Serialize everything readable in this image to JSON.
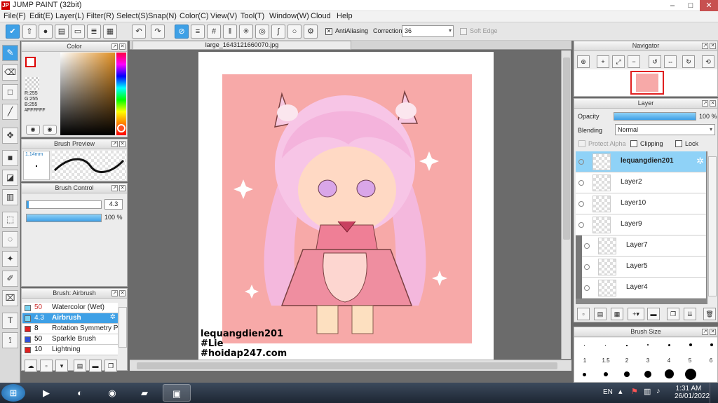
{
  "window": {
    "title": "JUMP PAINT (32bit)",
    "app_icon_text": "JP",
    "min": "–",
    "max": "□",
    "close": "✕"
  },
  "menu": [
    "File(F)",
    "Edit(E)",
    "Layer(L)",
    "Filter(R)",
    "Select(S)",
    "Snap(N)",
    "Color(C)",
    "View(V)",
    "Tool(T)",
    "Window(W)",
    "Cloud",
    "Help"
  ],
  "toolbar": {
    "antialiasing_label": "AntiAliasing",
    "correction_label": "Correction",
    "correction_value": "36",
    "soft_edge_label": "Soft Edge"
  },
  "document_tab": "large_1643121660070.jpg",
  "color_panel": {
    "title": "Color",
    "r": "R:255",
    "g": "G:255",
    "b": "B:255",
    "hex": "#FFFFFF"
  },
  "brush_preview": {
    "title": "Brush Preview",
    "size_label": "1.14mm"
  },
  "brush_control": {
    "title": "Brush Control",
    "size_value": "4.3",
    "opacity_value": "100 %",
    "opacity_fraction": 1.0
  },
  "brush_list": {
    "title": "Brush: Airbrush",
    "items": [
      {
        "value": "50",
        "name": "Watercolor (Wet)",
        "color": "#78d2f0",
        "selected": false
      },
      {
        "value": "4.3",
        "name": "Airbrush",
        "color": "#78d2f0",
        "selected": true
      },
      {
        "value": "8",
        "name": "Rotation Symmetry Pen",
        "color": "#e02020",
        "selected": false
      },
      {
        "value": "50",
        "name": "Sparkle Brush",
        "color": "#3050d8",
        "selected": false
      },
      {
        "value": "10",
        "name": "Lightning",
        "color": "#e02020",
        "selected": false
      }
    ]
  },
  "watermark": {
    "line1": "lequangdien201",
    "line2": "#Lie",
    "line3": "#hoidap247.com"
  },
  "navigator": {
    "title": "Navigator"
  },
  "layer_panel": {
    "title": "Layer",
    "opacity_label": "Opacity",
    "opacity_value": "100 %",
    "opacity_fraction": 1.0,
    "blending_label": "Blending",
    "blending_value": "Normal",
    "protect_alpha_label": "Protect Alpha",
    "clipping_label": "Clipping",
    "lock_label": "Lock",
    "layers": [
      {
        "name": "lequangdien201",
        "selected": true,
        "indent": false
      },
      {
        "name": "Layer2",
        "selected": false,
        "indent": false
      },
      {
        "name": "Layer10",
        "selected": false,
        "indent": false
      },
      {
        "name": "Layer9",
        "selected": false,
        "indent": false
      },
      {
        "name": "Layer7",
        "selected": false,
        "indent": true
      },
      {
        "name": "Layer5",
        "selected": false,
        "indent": true
      },
      {
        "name": "Layer4",
        "selected": false,
        "indent": true
      }
    ]
  },
  "brush_size": {
    "title": "Brush Size",
    "sizes": [
      "1",
      "1.5",
      "2",
      "3",
      "4",
      "5",
      "6"
    ]
  },
  "taskbar": {
    "lang": "EN",
    "time": "1:31 AM",
    "date": "26/01/2022"
  },
  "colors": {
    "accent": "#3ea0e6",
    "selected_layer": "#8fd2f7",
    "canvas_pink": "#f7a9a8"
  }
}
